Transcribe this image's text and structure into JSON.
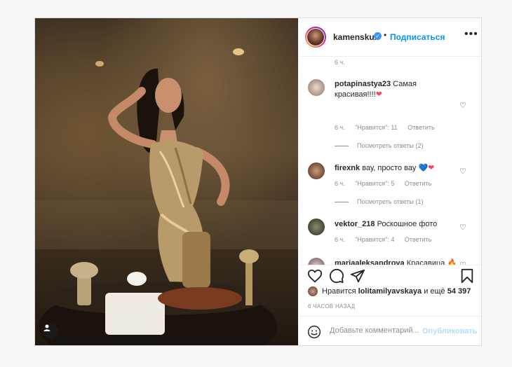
{
  "post": {
    "username": "kamenskux",
    "verified_mark": "✓",
    "dot": "•",
    "follow_label": "Подписаться",
    "more_label": "•••",
    "top_time": "6 ч.",
    "photo_icon": "user-tag-icon"
  },
  "comments": [
    {
      "user": "potapinastya23",
      "text": "Самая красивая!!!!",
      "emoji": "❤",
      "time": "6 ч.",
      "likes": "\"Нравится\": 11",
      "reply": "Ответить",
      "replies": "Посмотреть ответы (2)"
    },
    {
      "user": "firexnk",
      "text": "вау, просто вау",
      "emoji": "❤",
      "time": "6 ч.",
      "likes": "\"Нравится\": 5",
      "reply": "Ответить",
      "replies": "Посмотреть ответы (1)"
    },
    {
      "user": "vektor_218",
      "text": "Роскошное фото",
      "emoji": "",
      "time": "6 ч.",
      "likes": "\"Нравится\": 4",
      "reply": "Ответить",
      "replies": ""
    },
    {
      "user": "mariaaleksandrova",
      "text": "Красавица",
      "emoji": "🔥🔥🔥🔥🔥",
      "time": "",
      "likes": "",
      "reply": "",
      "replies": ""
    }
  ],
  "actions": {
    "likes_prefix": "Нравится",
    "likes_user": "lolitamilyavskaya",
    "likes_suffix": "и ещё",
    "likes_count": "54 397",
    "posted_time": "6 ЧАСОВ НАЗАД"
  },
  "add_comment": {
    "placeholder": "Добавьте комментарий...",
    "publish_label": "Опубликовать"
  },
  "colors": {
    "accent": "#0095f6",
    "heart": "#ed4956",
    "muted": "#8e8e8e"
  }
}
